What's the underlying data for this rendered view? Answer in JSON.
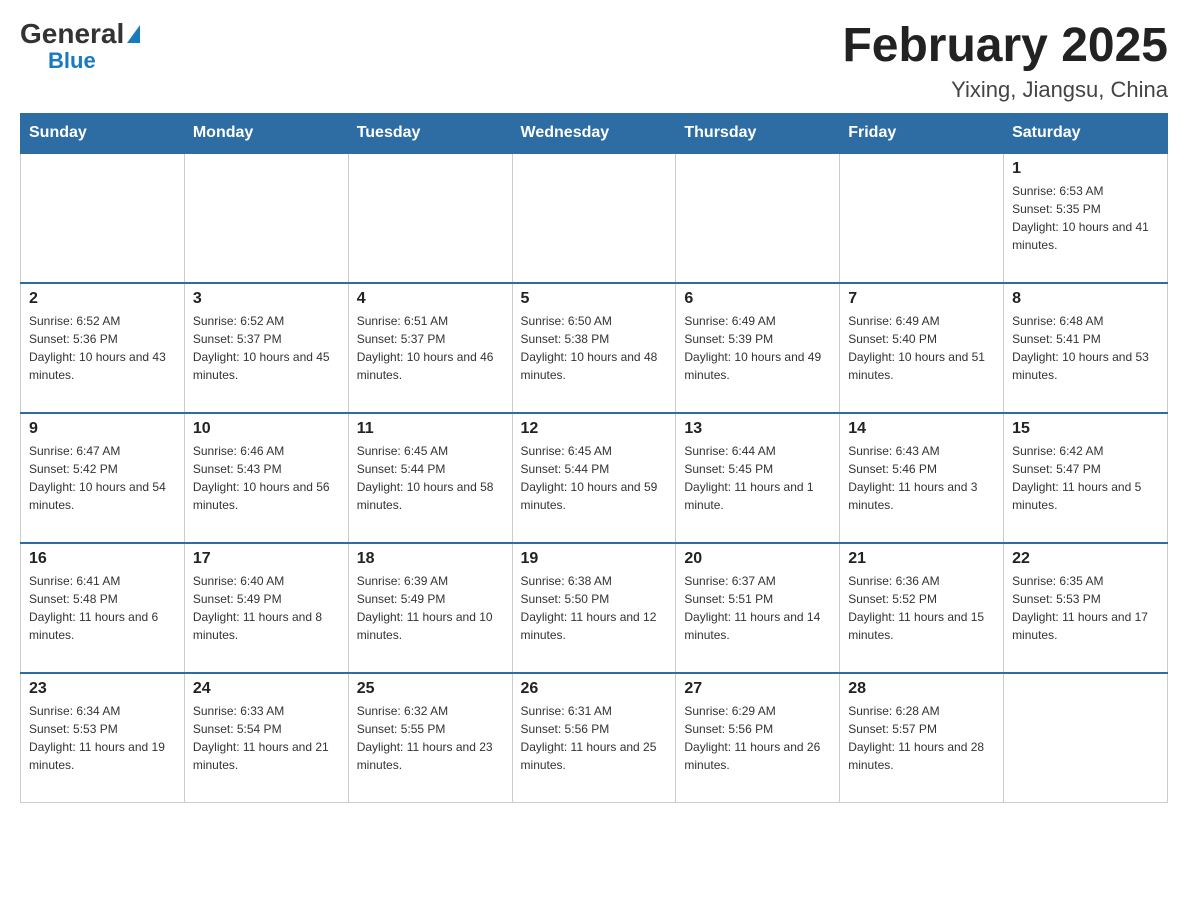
{
  "header": {
    "logo_general": "General",
    "logo_blue": "Blue",
    "month_title": "February 2025",
    "location": "Yixing, Jiangsu, China"
  },
  "weekdays": [
    "Sunday",
    "Monday",
    "Tuesday",
    "Wednesday",
    "Thursday",
    "Friday",
    "Saturday"
  ],
  "weeks": [
    {
      "days": [
        {
          "num": "",
          "info": ""
        },
        {
          "num": "",
          "info": ""
        },
        {
          "num": "",
          "info": ""
        },
        {
          "num": "",
          "info": ""
        },
        {
          "num": "",
          "info": ""
        },
        {
          "num": "",
          "info": ""
        },
        {
          "num": "1",
          "info": "Sunrise: 6:53 AM\nSunset: 5:35 PM\nDaylight: 10 hours and 41 minutes."
        }
      ]
    },
    {
      "days": [
        {
          "num": "2",
          "info": "Sunrise: 6:52 AM\nSunset: 5:36 PM\nDaylight: 10 hours and 43 minutes."
        },
        {
          "num": "3",
          "info": "Sunrise: 6:52 AM\nSunset: 5:37 PM\nDaylight: 10 hours and 45 minutes."
        },
        {
          "num": "4",
          "info": "Sunrise: 6:51 AM\nSunset: 5:37 PM\nDaylight: 10 hours and 46 minutes."
        },
        {
          "num": "5",
          "info": "Sunrise: 6:50 AM\nSunset: 5:38 PM\nDaylight: 10 hours and 48 minutes."
        },
        {
          "num": "6",
          "info": "Sunrise: 6:49 AM\nSunset: 5:39 PM\nDaylight: 10 hours and 49 minutes."
        },
        {
          "num": "7",
          "info": "Sunrise: 6:49 AM\nSunset: 5:40 PM\nDaylight: 10 hours and 51 minutes."
        },
        {
          "num": "8",
          "info": "Sunrise: 6:48 AM\nSunset: 5:41 PM\nDaylight: 10 hours and 53 minutes."
        }
      ]
    },
    {
      "days": [
        {
          "num": "9",
          "info": "Sunrise: 6:47 AM\nSunset: 5:42 PM\nDaylight: 10 hours and 54 minutes."
        },
        {
          "num": "10",
          "info": "Sunrise: 6:46 AM\nSunset: 5:43 PM\nDaylight: 10 hours and 56 minutes."
        },
        {
          "num": "11",
          "info": "Sunrise: 6:45 AM\nSunset: 5:44 PM\nDaylight: 10 hours and 58 minutes."
        },
        {
          "num": "12",
          "info": "Sunrise: 6:45 AM\nSunset: 5:44 PM\nDaylight: 10 hours and 59 minutes."
        },
        {
          "num": "13",
          "info": "Sunrise: 6:44 AM\nSunset: 5:45 PM\nDaylight: 11 hours and 1 minute."
        },
        {
          "num": "14",
          "info": "Sunrise: 6:43 AM\nSunset: 5:46 PM\nDaylight: 11 hours and 3 minutes."
        },
        {
          "num": "15",
          "info": "Sunrise: 6:42 AM\nSunset: 5:47 PM\nDaylight: 11 hours and 5 minutes."
        }
      ]
    },
    {
      "days": [
        {
          "num": "16",
          "info": "Sunrise: 6:41 AM\nSunset: 5:48 PM\nDaylight: 11 hours and 6 minutes."
        },
        {
          "num": "17",
          "info": "Sunrise: 6:40 AM\nSunset: 5:49 PM\nDaylight: 11 hours and 8 minutes."
        },
        {
          "num": "18",
          "info": "Sunrise: 6:39 AM\nSunset: 5:49 PM\nDaylight: 11 hours and 10 minutes."
        },
        {
          "num": "19",
          "info": "Sunrise: 6:38 AM\nSunset: 5:50 PM\nDaylight: 11 hours and 12 minutes."
        },
        {
          "num": "20",
          "info": "Sunrise: 6:37 AM\nSunset: 5:51 PM\nDaylight: 11 hours and 14 minutes."
        },
        {
          "num": "21",
          "info": "Sunrise: 6:36 AM\nSunset: 5:52 PM\nDaylight: 11 hours and 15 minutes."
        },
        {
          "num": "22",
          "info": "Sunrise: 6:35 AM\nSunset: 5:53 PM\nDaylight: 11 hours and 17 minutes."
        }
      ]
    },
    {
      "days": [
        {
          "num": "23",
          "info": "Sunrise: 6:34 AM\nSunset: 5:53 PM\nDaylight: 11 hours and 19 minutes."
        },
        {
          "num": "24",
          "info": "Sunrise: 6:33 AM\nSunset: 5:54 PM\nDaylight: 11 hours and 21 minutes."
        },
        {
          "num": "25",
          "info": "Sunrise: 6:32 AM\nSunset: 5:55 PM\nDaylight: 11 hours and 23 minutes."
        },
        {
          "num": "26",
          "info": "Sunrise: 6:31 AM\nSunset: 5:56 PM\nDaylight: 11 hours and 25 minutes."
        },
        {
          "num": "27",
          "info": "Sunrise: 6:29 AM\nSunset: 5:56 PM\nDaylight: 11 hours and 26 minutes."
        },
        {
          "num": "28",
          "info": "Sunrise: 6:28 AM\nSunset: 5:57 PM\nDaylight: 11 hours and 28 minutes."
        },
        {
          "num": "",
          "info": ""
        }
      ]
    }
  ]
}
